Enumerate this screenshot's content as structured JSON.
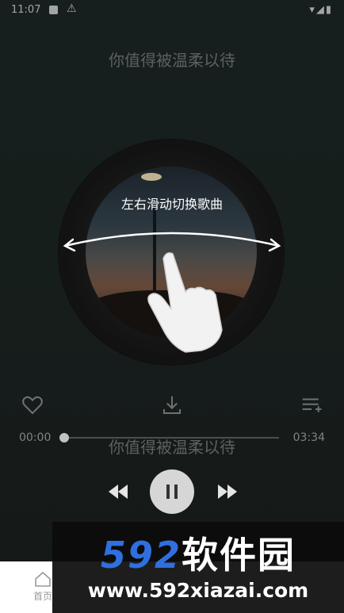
{
  "status_bar": {
    "time": "11:07",
    "right_icons": "▾◢▮"
  },
  "player": {
    "song_title": "你值得被温柔以待",
    "swipe_hint": "左右滑动切换歌曲",
    "lyric_line": "你值得被温柔以待",
    "current_time": "00:00",
    "total_time": "03:34",
    "progress_fraction": 0.0,
    "playing": true
  },
  "actions": {
    "like": "heart-icon",
    "download": "download-icon",
    "playlist": "playlist-add-icon"
  },
  "nav": {
    "home_label": "首页"
  },
  "watermark": {
    "brand_number": "592",
    "brand_text": "软件园",
    "url": "www.592xiazai.com"
  },
  "colors": {
    "background": "#1d2725",
    "accent_blue": "#2f6fe0",
    "play_button": "#d6d6d6"
  }
}
